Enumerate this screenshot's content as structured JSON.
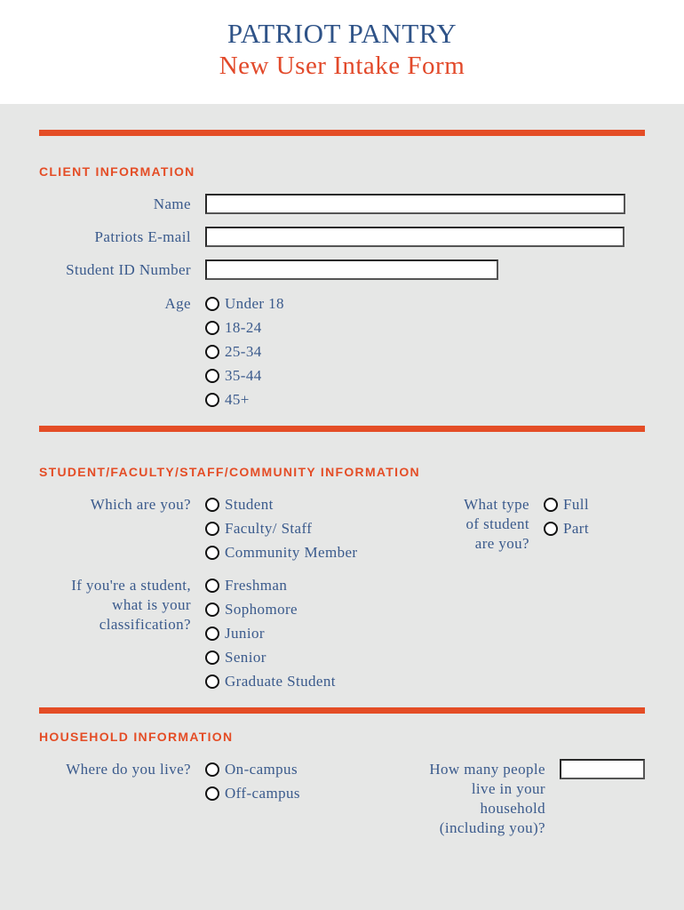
{
  "header": {
    "title": "PATRIOT PANTRY",
    "subtitle": "New User Intake Form"
  },
  "colors": {
    "accent": "#e44d26",
    "text": "#3a5a8c",
    "title": "#2f5388",
    "background": "#e6e7e6"
  },
  "client": {
    "heading": "CLIENT INFORMATION",
    "name_label": "Name",
    "name_value": "",
    "email_label": "Patriots E-mail",
    "email_value": "",
    "student_id_label": "Student ID Number",
    "student_id_value": "",
    "age_label": "Age",
    "age_options": [
      "Under 18",
      "18-24",
      "25-34",
      "35-44",
      "45+"
    ]
  },
  "affiliation": {
    "heading": "STUDENT/FACULTY/STAFF/COMMUNITY INFORMATION",
    "which_label": "Which are you?",
    "which_options": [
      "Student",
      "Faculty/ Staff",
      "Community Member"
    ],
    "type_label_lines": [
      "What type",
      "of student",
      "are you?"
    ],
    "type_options": [
      "Full",
      "Part"
    ],
    "class_label_lines": [
      "If you're a student,",
      "what is your",
      "classification?"
    ],
    "class_options": [
      "Freshman",
      "Sophomore",
      "Junior",
      "Senior",
      "Graduate Student"
    ]
  },
  "household": {
    "heading": "HOUSEHOLD INFORMATION",
    "live_label": "Where do you live?",
    "live_options": [
      "On-campus",
      "Off-campus"
    ],
    "count_label_lines": [
      "How many people",
      "live in your",
      "household",
      "(including you)?"
    ],
    "count_value": ""
  }
}
